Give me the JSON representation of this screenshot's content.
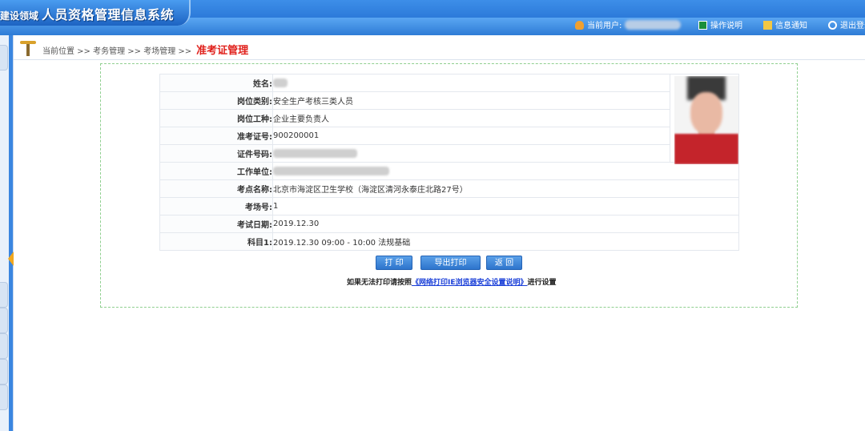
{
  "header": {
    "logo_small": "建设领域",
    "logo_big": "人员资格管理信息系统",
    "current_user_label": "当前用户:",
    "help_label": "操作说明",
    "notify_label": "信息通知",
    "logout_label": "退出登录",
    "colors": {
      "primary": "#2a78d8",
      "accent": "#e0201b"
    }
  },
  "breadcrumb": {
    "prefix": "当前位置 >> 考务管理 >> 考场管理 >>",
    "current": "准考证管理"
  },
  "ticket": {
    "rows": [
      {
        "label": "姓名:",
        "value": ""
      },
      {
        "label": "岗位类别:",
        "value": "安全生产考核三类人员"
      },
      {
        "label": "岗位工种:",
        "value": "企业主要负责人"
      },
      {
        "label": "准考证号:",
        "value": "900200001"
      },
      {
        "label": "证件号码:",
        "value": ""
      },
      {
        "label": "工作单位:",
        "value": ""
      },
      {
        "label": "考点名称:",
        "value": "北京市海淀区卫生学校（海淀区清河永泰庄北路27号）"
      },
      {
        "label": "考场号:",
        "value": "1"
      },
      {
        "label": "考试日期:",
        "value": "2019.12.30"
      },
      {
        "label": "科目1:",
        "value": "2019.12.30 09:00 - 10:00 法规基础"
      }
    ]
  },
  "buttons": {
    "print": "打 印",
    "export_print": "导出打印",
    "back": "返 回"
  },
  "note": {
    "prefix": "如果无法打印请按照",
    "link": "《网络打印IE浏览器安全设置说明》",
    "suffix": "进行设置"
  }
}
